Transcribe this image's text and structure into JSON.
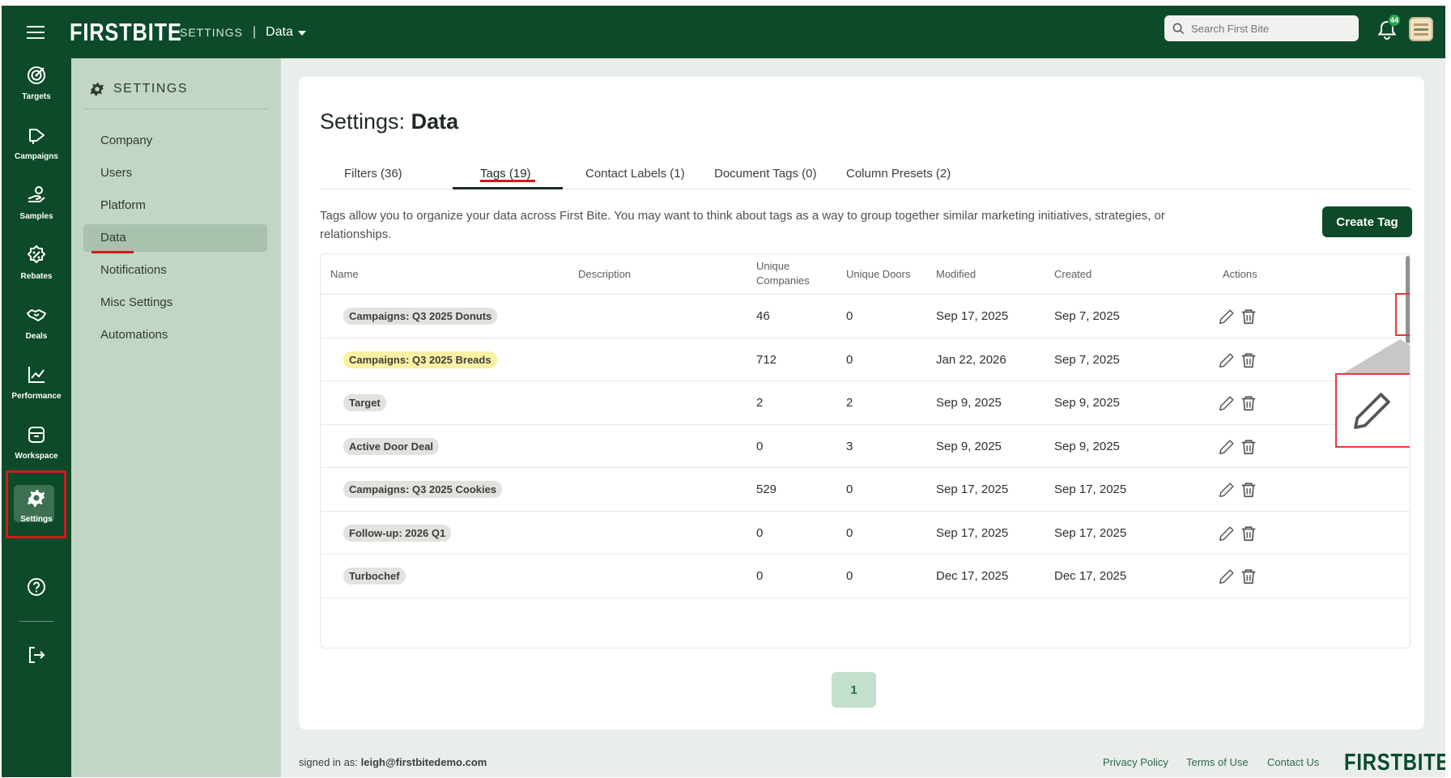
{
  "app": {
    "logo": "FIRSTBITE",
    "accent": "#0c4a2a",
    "highlight": "#d11a1a"
  },
  "topbar": {
    "breadcrumb_section": "SETTINGS",
    "breadcrumb_sep": "|",
    "breadcrumb_page": "Data",
    "search_placeholder": "Search First Bite",
    "notification_count": "44",
    "icons": [
      "menu-icon",
      "search-icon",
      "bell-icon",
      "avatar"
    ]
  },
  "rail": {
    "items": [
      {
        "label": "Targets",
        "icon": "target-icon"
      },
      {
        "label": "Campaigns",
        "icon": "campaign-icon"
      },
      {
        "label": "Samples",
        "icon": "samples-icon"
      },
      {
        "label": "Rebates",
        "icon": "rebate-icon"
      },
      {
        "label": "Deals",
        "icon": "handshake-icon"
      },
      {
        "label": "Performance",
        "icon": "chart-line-icon"
      },
      {
        "label": "Workspace",
        "icon": "inbox-icon"
      },
      {
        "label": "Settings",
        "icon": "gear-icon",
        "active": true
      }
    ],
    "bottom_icons": [
      "help-icon",
      "logout-icon"
    ]
  },
  "subnav": {
    "title": "SETTINGS",
    "items": [
      {
        "label": "Company"
      },
      {
        "label": "Users"
      },
      {
        "label": "Platform"
      },
      {
        "label": "Data",
        "active": true
      },
      {
        "label": "Notifications"
      },
      {
        "label": "Misc Settings"
      },
      {
        "label": "Automations"
      }
    ]
  },
  "main": {
    "title_prefix": "Settings:",
    "title_bold": "Data",
    "tabs": [
      {
        "label": "Filters (36)"
      },
      {
        "label": "Tags (19)",
        "active": true
      },
      {
        "label": "Contact Labels (1)"
      },
      {
        "label": "Document Tags (0)"
      },
      {
        "label": "Column Presets (2)"
      }
    ],
    "description": "Tags allow you to organize your data across First Bite. You may want to think about tags as a way to group together similar marketing initiatives, strategies, or relationships.",
    "create_button": "Create Tag",
    "table": {
      "headers": {
        "name": "Name",
        "description": "Description",
        "unique_companies": "Unique Companies",
        "unique_doors": "Unique Doors",
        "modified": "Modified",
        "created": "Created",
        "actions": "Actions"
      },
      "rows": [
        {
          "name": "Campaigns: Q3 2025 Donuts",
          "description": "",
          "unique_companies": "46",
          "unique_doors": "0",
          "modified": "Sep 17, 2025",
          "created": "Sep 7, 2025",
          "tag_color": "#e2e2de"
        },
        {
          "name": "Campaigns: Q3 2025 Breads",
          "description": "",
          "unique_companies": "712",
          "unique_doors": "0",
          "modified": "Jan 22, 2026",
          "created": "Sep 7, 2025",
          "tag_color": "#fbf1a4"
        },
        {
          "name": "Target",
          "description": "",
          "unique_companies": "2",
          "unique_doors": "2",
          "modified": "Sep 9, 2025",
          "created": "Sep 9, 2025",
          "tag_color": "#e2e2de"
        },
        {
          "name": "Active Door Deal",
          "description": "",
          "unique_companies": "0",
          "unique_doors": "3",
          "modified": "Sep 9, 2025",
          "created": "Sep 9, 2025",
          "tag_color": "#e2e2de"
        },
        {
          "name": "Campaigns: Q3 2025 Cookies",
          "description": "",
          "unique_companies": "529",
          "unique_doors": "0",
          "modified": "Sep 17, 2025",
          "created": "Sep 17, 2025",
          "tag_color": "#e2e2de"
        },
        {
          "name": "Follow-up: 2026 Q1",
          "description": "",
          "unique_companies": "0",
          "unique_doors": "0",
          "modified": "Sep 17, 2025",
          "created": "Sep 17, 2025",
          "tag_color": "#e2e2de"
        },
        {
          "name": "Turbochef",
          "description": "",
          "unique_companies": "0",
          "unique_doors": "0",
          "modified": "Dec 17, 2025",
          "created": "Dec 17, 2025",
          "tag_color": "#e2e2de"
        }
      ]
    },
    "pagination": {
      "current_page": "1"
    }
  },
  "footer": {
    "signed_in_label": "signed in as:",
    "signed_in_email": "leigh@firstbitedemo.com",
    "links": [
      "Privacy Policy",
      "Terms of Use",
      "Contact Us"
    ],
    "logo": "FIRSTBITE"
  }
}
